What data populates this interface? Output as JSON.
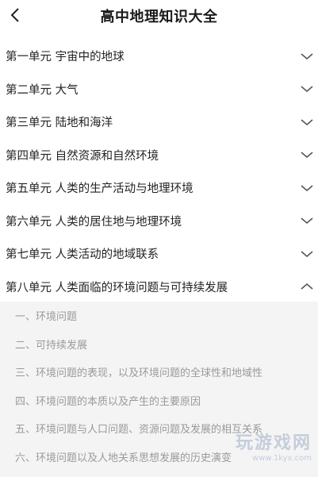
{
  "header": {
    "title": "高中地理知识大全"
  },
  "units": [
    {
      "label": "第一单元 宇宙中的地球",
      "expanded": false
    },
    {
      "label": "第二单元 大气",
      "expanded": false
    },
    {
      "label": "第三单元 陆地和海洋",
      "expanded": false
    },
    {
      "label": "第四单元 自然资源和自然环境",
      "expanded": false
    },
    {
      "label": "第五单元 人类的生产活动与地理环境",
      "expanded": false
    },
    {
      "label": "第六单元 人类的居住地与地理环境",
      "expanded": false
    },
    {
      "label": "第七单元 人类活动的地域联系",
      "expanded": false
    },
    {
      "label": "第八单元 人类面临的环境问题与可持续发展",
      "expanded": true
    }
  ],
  "sub_items": [
    {
      "label": "一、环境问题"
    },
    {
      "label": "二、可持续发展"
    },
    {
      "label": "三、环境问题的表现，以及环境问题的全球性和地域性"
    },
    {
      "label": "四、环境问题的本质以及产生的主要原因"
    },
    {
      "label": "五、环境问题与人口问题、资源问题及发展的相互关系"
    },
    {
      "label": "六、环境问题以及人地关系思想发展的历史演变"
    }
  ],
  "watermark": {
    "text": "玩游戏网",
    "url": "www.1kyx.com"
  },
  "colors": {
    "sub_background": "#f4f4f4",
    "sub_text": "#9a9a9a",
    "chevron": "#555555"
  }
}
